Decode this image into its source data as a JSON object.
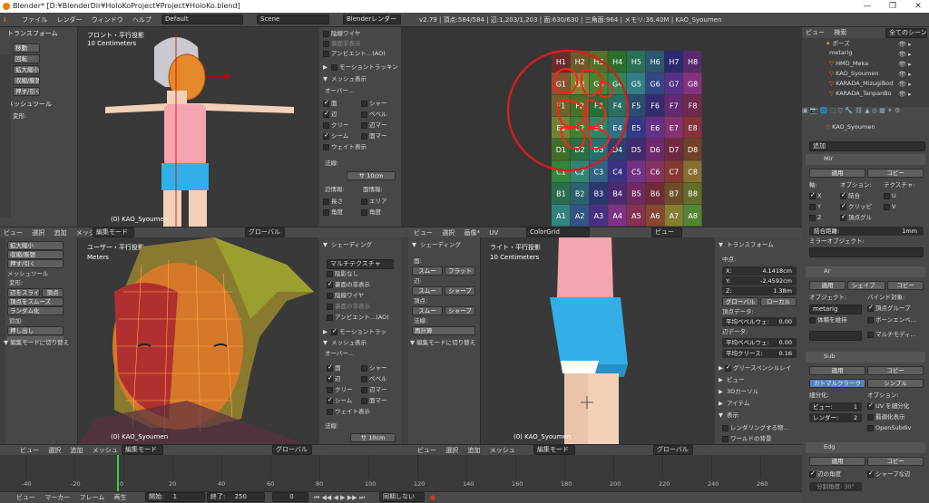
{
  "window": {
    "title": "Blender* [D:¥BlenderDir¥HoloKoProject¥Project¥HoloKo.blend]"
  },
  "menu": {
    "items": [
      "ファイル",
      "レンダー",
      "ウィンドウ",
      "ヘルプ"
    ],
    "layout": "Default",
    "scene": "Scene",
    "engine": "Blenderレンダー",
    "stats": "v2.79 | 頂点:584/584 | 辺:1,203/1,203 | 面:630/630 | 三角面:964 | メモリ:36.40M | KAO_Syoumen"
  },
  "tl_tools": {
    "transform": "トランスフォーム",
    "buttons": [
      "移動",
      "回転",
      "拡大縮小",
      "収縮/膨張",
      "押す/引く"
    ],
    "mesh_tools": "メッシュツール",
    "deform": "変形:"
  },
  "tl_vp": {
    "name": "フロント・平行投影",
    "unit": "10 Centimeters",
    "object": "(0) KAO_Syoumen"
  },
  "tl_props": {
    "hidden_wire": "陰線ワイヤ",
    "backface": "裏面非表示",
    "ao": "アンビエント…(AO)",
    "motion": "モーショントラッキン",
    "mesh_display": "メッシュ表示",
    "overlay": "オーバー…",
    "checks": [
      "面",
      "シャー",
      "辺",
      "ベベル",
      "クリー",
      "辺マー",
      "シーム",
      "面マー",
      "ウェイト表示"
    ],
    "normals": "法線:",
    "size": "サ 10cm",
    "edge_info": "辺情報:",
    "face_info": "面情報:",
    "len": "長さ",
    "area": "エリア",
    "angle": "角度",
    "angle2": "角度"
  },
  "uv": {
    "status": "v2.79 | 頂点:584/584 | 辺:1,203/1,203 | 面:630/630 | 三角面:964 | メモリ:36.40M | KAO_Syoumen",
    "labels": [
      "H1",
      "H2",
      "H3",
      "H4",
      "H5",
      "H6",
      "H7",
      "H8",
      "G1",
      "G2",
      "G3",
      "G4",
      "G5",
      "G6",
      "G7",
      "G8",
      "F1",
      "F2",
      "F3",
      "F4",
      "F5",
      "F6",
      "F7",
      "F8",
      "E1",
      "E2",
      "E3",
      "E4",
      "E5",
      "E6",
      "E7",
      "E8",
      "D1",
      "D2",
      "D3",
      "D4",
      "D5",
      "D6",
      "D7",
      "D8",
      "C1",
      "C2",
      "C3",
      "C4",
      "C5",
      "C6",
      "C7",
      "C8",
      "B1",
      "B2",
      "B3",
      "B4",
      "B5",
      "B6",
      "B7",
      "B8",
      "A1",
      "A2",
      "A3",
      "A4",
      "A5",
      "A6",
      "A7",
      "A8"
    ]
  },
  "outliner": {
    "view": "ビュー",
    "search": "検索",
    "all": "全てのシーン",
    "items": [
      "ポーズ",
      "metarig",
      "HMD_Meka",
      "KAO_Syoumen",
      "KARADA_MizugiBod",
      "KARADA_TanpanBo"
    ]
  },
  "props": {
    "object": "KAO_Syoumen",
    "add": "追加",
    "m1": "Mir",
    "apply": "適用",
    "copy": "コピー",
    "axis": "軸:",
    "options": "オプション:",
    "texture": "テクスチャ:",
    "x": "X",
    "y": "Y",
    "z": "Z",
    "merge": "結合",
    "clip": "クリッピ",
    "vgroup": "頂点グル",
    "u": "U",
    "v": "V",
    "merge_dist": "結合距離:",
    "merge_val": "1mm",
    "mirror_obj": "ミラーオブジェクト:",
    "m2": "Ar",
    "shape": "シェイプ…",
    "object_lbl": "オブジェクト:",
    "bind": "バインド対象:",
    "metarig": "metarig",
    "vertex_group": "頂点グループ",
    "keep_vol": "体積を維持",
    "bone_env": "ボーンエンベ…",
    "multi": "マルチモディ…",
    "m3": "Sub",
    "catmull": "カトマルクラーク",
    "simple": "シンプル",
    "subdiv": "細分化:",
    "opt2": "オプション:",
    "view": "ビュー:",
    "view_val": "1",
    "render": "レンダー:",
    "render_val": "2",
    "uv_smooth": "UV を細分化",
    "opt_display": "最適化表示",
    "open_subdiv": "OpenSubdiv",
    "m4": "Edg",
    "edge_angle": "辺の角度",
    "sharp": "シャープな辺",
    "split_angle": "分割角度: 30°"
  },
  "bl_tools": {
    "items": [
      "拡大縮小",
      "収縮/膨張",
      "押す/引く"
    ],
    "mesh_tools": "メッシュツール",
    "deform": "変形:",
    "slide": "辺をスライド",
    "vslide": "頂点",
    "smooth": "頂点をスムーズ",
    "random": "ランダム化",
    "add": "追加:",
    "push": "押し出し",
    "edit_mode": "▼ 編集モードに切り替え"
  },
  "bl_vp": {
    "name": "ユーザー・平行投影",
    "unit": "Meters",
    "object": "(0) KAO_Syoumen"
  },
  "bl_props": {
    "shading": "シェーディング",
    "multitex": "マルチテクスチャ",
    "tex_solid": "陰影なし",
    "backface": "裏面の非表示",
    "hidden_wire": "陰線ワイヤ",
    "ao": "アンビエント…(AO)",
    "motion": "モーショントラッ",
    "mesh_display": "メッシュ表示",
    "overlay": "オーバー…",
    "checks": [
      "面",
      "シャー",
      "辺",
      "ベベル",
      "クリー",
      "辺マー",
      "シーム",
      "面マー",
      "ウェイト表示"
    ],
    "normals": "法線:",
    "size": "サ 10cm"
  },
  "br_tools": {
    "shading": "シェーディング",
    "face": "面:",
    "smooth": "スムー",
    "flat": "フラット",
    "edge": "辺:",
    "smooth2": "スムー",
    "sharp": "シャープ",
    "vertex": "頂点:",
    "smooth3": "スムー",
    "sharp2": "シャープ",
    "normals": "法線:",
    "recalc": "再計算",
    "edit_mode": "▼ 編集モードに切り替え"
  },
  "br_vp": {
    "name": "ライト・平行投影",
    "unit": "10 Centimeters",
    "object": "(0) KAO_Syoumen"
  },
  "br_props": {
    "transform": "トランスフォーム",
    "median": "中点:",
    "x": "X:",
    "xv": "4.1418cm",
    "y": "Y:",
    "yv": "-2.4592cm",
    "z": "Z:",
    "zv": "1.38m",
    "global": "グローバル",
    "local": "ローカル",
    "vdata": "頂点データ:",
    "bevel_w": "平均ベベルウェ:",
    "bevel_wv": "0.00",
    "edata": "辺データ:",
    "bevel_w2": "平均ベベルウェ:",
    "bevel_w2v": "0.00",
    "crease": "平均クリース:",
    "crease_v": "0.16",
    "grease": "グリースペンシルレイ",
    "view": "ビュー",
    "cursor": "3Dカーソル",
    "item": "アイテム",
    "display": "表示",
    "render_only": "レンダリングする物…",
    "world_bg": "ワールドの背景"
  },
  "hdr_tl": [
    "ビュー",
    "選択",
    "追加",
    "メッシュ"
  ],
  "hdr_common": {
    "edit_mode": "編集モード",
    "global": "グローバル"
  },
  "hdr_uv": {
    "items": [
      "ビュー",
      "選択",
      "画像*",
      "UV"
    ],
    "image": "ColorGrid",
    "view": "ビュー"
  },
  "timeline": {
    "items": [
      "ビュー",
      "マーカー",
      "フレーム",
      "再生"
    ],
    "start": "開始:",
    "start_v": "1",
    "end": "終了:",
    "end_v": "250",
    "frame": "0",
    "sync": "同期しない",
    "ticks": [
      "-40",
      "-20",
      "0",
      "20",
      "40",
      "60",
      "80",
      "100",
      "120",
      "140",
      "160",
      "180",
      "200",
      "220",
      "240",
      "260"
    ]
  },
  "colors": {
    "accent": "#5680c2",
    "blender_orange": "#e87d0d",
    "circle": "#d02020"
  }
}
